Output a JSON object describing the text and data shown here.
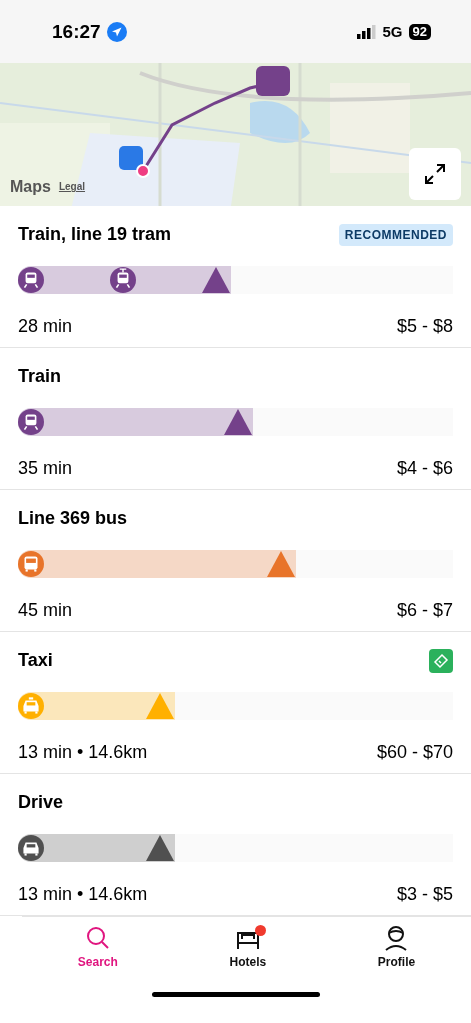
{
  "status_bar": {
    "time": "16:27",
    "location_on": true,
    "network": "5G",
    "battery": "92"
  },
  "map": {
    "attribution": "Maps",
    "legal_link": "Legal"
  },
  "routes": [
    {
      "title": "Train, line 19 tram",
      "tag": {
        "kind": "text",
        "label": "RECOMMENDED"
      },
      "color": "#74418a",
      "level": 0.49,
      "segments": [
        {
          "kind": "train"
        },
        {
          "kind": "tram"
        }
      ],
      "duration": "28 min",
      "price": "$5 - $8"
    },
    {
      "title": "Train",
      "color": "#74418a",
      "level": 0.54,
      "segments": [
        {
          "kind": "train"
        }
      ],
      "duration": "35 min",
      "price": "$4 - $6"
    },
    {
      "title": "Line 369 bus",
      "color": "#e8742a",
      "level": 0.64,
      "segments": [
        {
          "kind": "bus"
        }
      ],
      "duration": "45 min",
      "price": "$6 - $7"
    },
    {
      "title": "Taxi",
      "tag": {
        "kind": "ticket"
      },
      "color": "#ffb000",
      "level": 0.36,
      "segments": [
        {
          "kind": "taxi"
        }
      ],
      "duration": "13 min • 14.6km",
      "price": "$60 - $70"
    },
    {
      "title": "Drive",
      "color": "#505050",
      "level": 0.36,
      "segments": [
        {
          "kind": "car"
        }
      ],
      "duration": "13 min • 14.6km",
      "price": "$3 - $5"
    }
  ],
  "tabs": [
    {
      "kind": "search",
      "label": "Search",
      "selected": true,
      "badge": false
    },
    {
      "kind": "hotels",
      "label": "Hotels",
      "selected": false,
      "badge": true
    },
    {
      "kind": "profile",
      "label": "Profile",
      "selected": false,
      "badge": false
    }
  ]
}
